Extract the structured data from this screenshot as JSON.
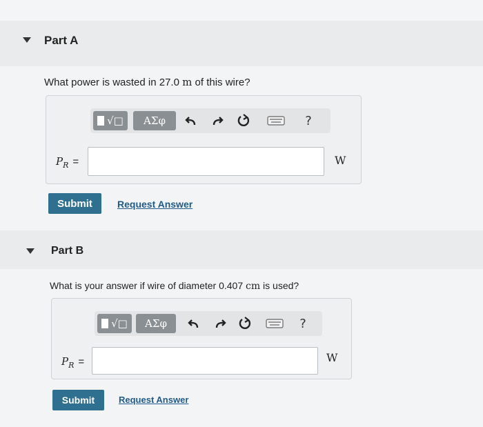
{
  "partA": {
    "title": "Part A",
    "question_pre": "What power is wasted in 27.0 ",
    "question_unit": "m",
    "question_post": " of this wire?",
    "toolbar": {
      "templates_label": "√□",
      "symbols_label": "ΑΣφ",
      "help_label": "?"
    },
    "variable_main": "P",
    "variable_sub": "R",
    "equals": "=",
    "input_value": "",
    "unit": "W",
    "submit_label": "Submit",
    "request_label": "Request Answer"
  },
  "partB": {
    "title": "Part B",
    "question_pre": "What is your answer if wire of diameter 0.407 ",
    "question_unit": "cm",
    "question_post": " is used?",
    "toolbar": {
      "templates_label": "√□",
      "symbols_label": "ΑΣφ",
      "help_label": "?"
    },
    "variable_main": "P",
    "variable_sub": "R",
    "equals": "=",
    "input_value": "",
    "unit": "W",
    "submit_label": "Submit",
    "request_label": "Request Answer"
  },
  "colors": {
    "submit": "#2f6f8f",
    "link": "#1f5a8a",
    "tool_button": "#8a8f94"
  }
}
